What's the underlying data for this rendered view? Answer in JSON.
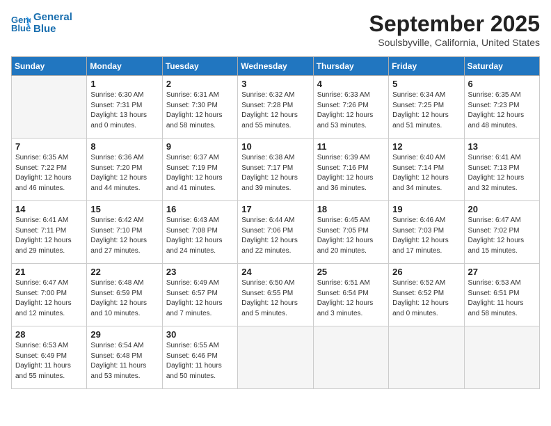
{
  "header": {
    "logo_line1": "General",
    "logo_line2": "Blue",
    "month_title": "September 2025",
    "subtitle": "Soulsbyville, California, United States"
  },
  "weekdays": [
    "Sunday",
    "Monday",
    "Tuesday",
    "Wednesday",
    "Thursday",
    "Friday",
    "Saturday"
  ],
  "weeks": [
    [
      {
        "day": "",
        "info": ""
      },
      {
        "day": "1",
        "info": "Sunrise: 6:30 AM\nSunset: 7:31 PM\nDaylight: 13 hours\nand 0 minutes."
      },
      {
        "day": "2",
        "info": "Sunrise: 6:31 AM\nSunset: 7:30 PM\nDaylight: 12 hours\nand 58 minutes."
      },
      {
        "day": "3",
        "info": "Sunrise: 6:32 AM\nSunset: 7:28 PM\nDaylight: 12 hours\nand 55 minutes."
      },
      {
        "day": "4",
        "info": "Sunrise: 6:33 AM\nSunset: 7:26 PM\nDaylight: 12 hours\nand 53 minutes."
      },
      {
        "day": "5",
        "info": "Sunrise: 6:34 AM\nSunset: 7:25 PM\nDaylight: 12 hours\nand 51 minutes."
      },
      {
        "day": "6",
        "info": "Sunrise: 6:35 AM\nSunset: 7:23 PM\nDaylight: 12 hours\nand 48 minutes."
      }
    ],
    [
      {
        "day": "7",
        "info": "Sunrise: 6:35 AM\nSunset: 7:22 PM\nDaylight: 12 hours\nand 46 minutes."
      },
      {
        "day": "8",
        "info": "Sunrise: 6:36 AM\nSunset: 7:20 PM\nDaylight: 12 hours\nand 44 minutes."
      },
      {
        "day": "9",
        "info": "Sunrise: 6:37 AM\nSunset: 7:19 PM\nDaylight: 12 hours\nand 41 minutes."
      },
      {
        "day": "10",
        "info": "Sunrise: 6:38 AM\nSunset: 7:17 PM\nDaylight: 12 hours\nand 39 minutes."
      },
      {
        "day": "11",
        "info": "Sunrise: 6:39 AM\nSunset: 7:16 PM\nDaylight: 12 hours\nand 36 minutes."
      },
      {
        "day": "12",
        "info": "Sunrise: 6:40 AM\nSunset: 7:14 PM\nDaylight: 12 hours\nand 34 minutes."
      },
      {
        "day": "13",
        "info": "Sunrise: 6:41 AM\nSunset: 7:13 PM\nDaylight: 12 hours\nand 32 minutes."
      }
    ],
    [
      {
        "day": "14",
        "info": "Sunrise: 6:41 AM\nSunset: 7:11 PM\nDaylight: 12 hours\nand 29 minutes."
      },
      {
        "day": "15",
        "info": "Sunrise: 6:42 AM\nSunset: 7:10 PM\nDaylight: 12 hours\nand 27 minutes."
      },
      {
        "day": "16",
        "info": "Sunrise: 6:43 AM\nSunset: 7:08 PM\nDaylight: 12 hours\nand 24 minutes."
      },
      {
        "day": "17",
        "info": "Sunrise: 6:44 AM\nSunset: 7:06 PM\nDaylight: 12 hours\nand 22 minutes."
      },
      {
        "day": "18",
        "info": "Sunrise: 6:45 AM\nSunset: 7:05 PM\nDaylight: 12 hours\nand 20 minutes."
      },
      {
        "day": "19",
        "info": "Sunrise: 6:46 AM\nSunset: 7:03 PM\nDaylight: 12 hours\nand 17 minutes."
      },
      {
        "day": "20",
        "info": "Sunrise: 6:47 AM\nSunset: 7:02 PM\nDaylight: 12 hours\nand 15 minutes."
      }
    ],
    [
      {
        "day": "21",
        "info": "Sunrise: 6:47 AM\nSunset: 7:00 PM\nDaylight: 12 hours\nand 12 minutes."
      },
      {
        "day": "22",
        "info": "Sunrise: 6:48 AM\nSunset: 6:59 PM\nDaylight: 12 hours\nand 10 minutes."
      },
      {
        "day": "23",
        "info": "Sunrise: 6:49 AM\nSunset: 6:57 PM\nDaylight: 12 hours\nand 7 minutes."
      },
      {
        "day": "24",
        "info": "Sunrise: 6:50 AM\nSunset: 6:55 PM\nDaylight: 12 hours\nand 5 minutes."
      },
      {
        "day": "25",
        "info": "Sunrise: 6:51 AM\nSunset: 6:54 PM\nDaylight: 12 hours\nand 3 minutes."
      },
      {
        "day": "26",
        "info": "Sunrise: 6:52 AM\nSunset: 6:52 PM\nDaylight: 12 hours\nand 0 minutes."
      },
      {
        "day": "27",
        "info": "Sunrise: 6:53 AM\nSunset: 6:51 PM\nDaylight: 11 hours\nand 58 minutes."
      }
    ],
    [
      {
        "day": "28",
        "info": "Sunrise: 6:53 AM\nSunset: 6:49 PM\nDaylight: 11 hours\nand 55 minutes."
      },
      {
        "day": "29",
        "info": "Sunrise: 6:54 AM\nSunset: 6:48 PM\nDaylight: 11 hours\nand 53 minutes."
      },
      {
        "day": "30",
        "info": "Sunrise: 6:55 AM\nSunset: 6:46 PM\nDaylight: 11 hours\nand 50 minutes."
      },
      {
        "day": "",
        "info": ""
      },
      {
        "day": "",
        "info": ""
      },
      {
        "day": "",
        "info": ""
      },
      {
        "day": "",
        "info": ""
      }
    ]
  ]
}
